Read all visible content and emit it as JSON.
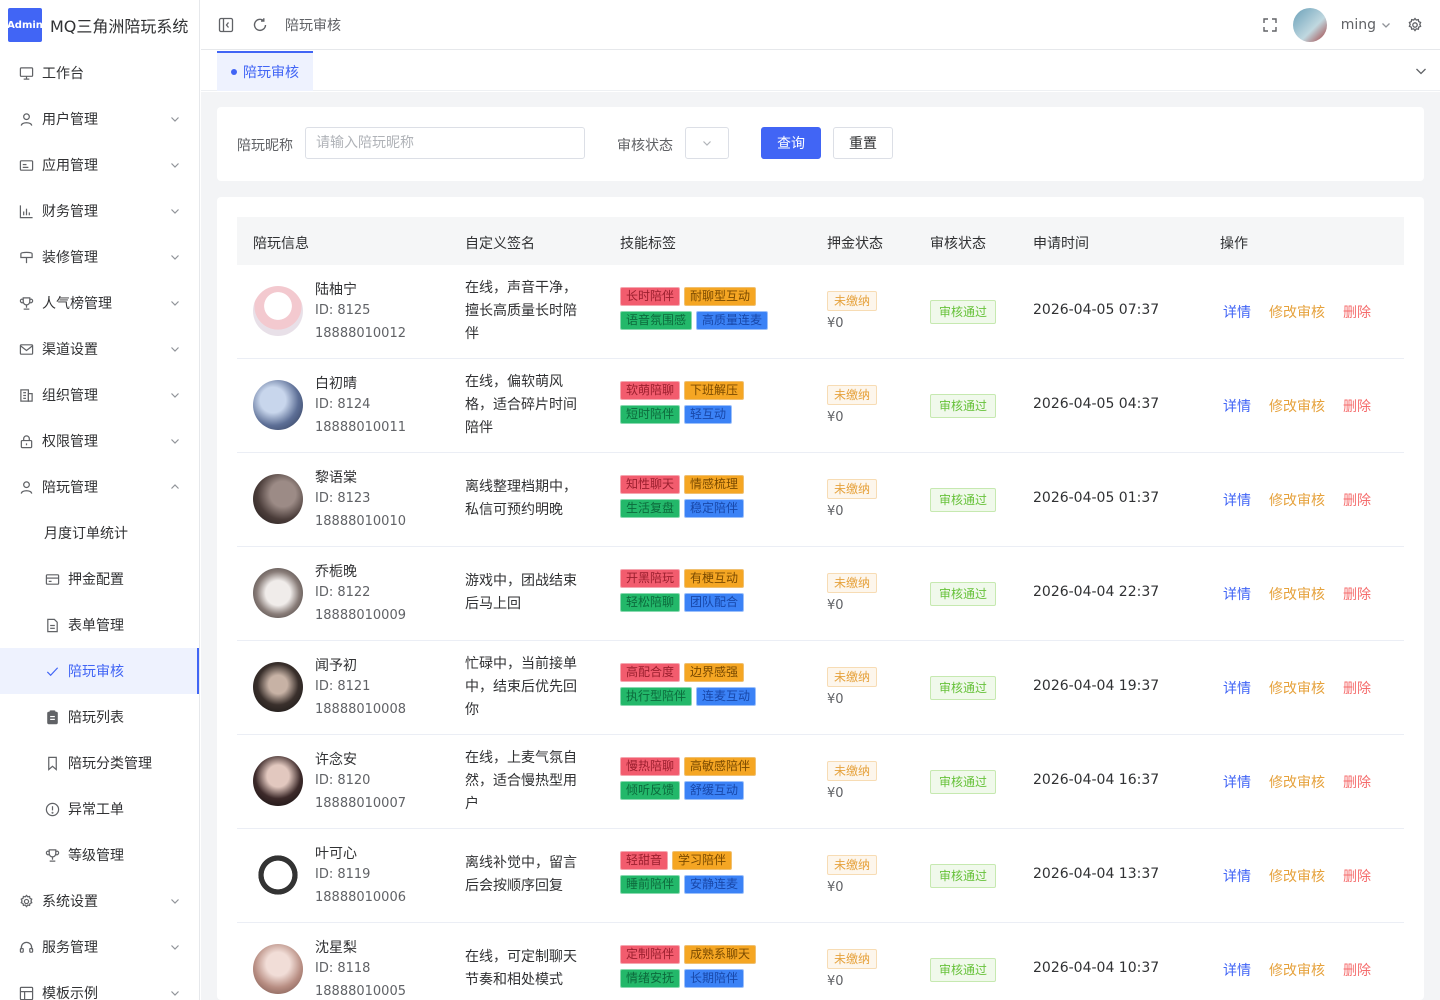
{
  "brand": {
    "logo": "Admin",
    "title": "MQ三角洲陪玩系统"
  },
  "menu": [
    {
      "label": "工作台",
      "icon": "monitor-icon",
      "arrow": false
    },
    {
      "label": "用户管理",
      "icon": "user-icon",
      "arrow": true
    },
    {
      "label": "应用管理",
      "icon": "app-icon",
      "arrow": true
    },
    {
      "label": "财务管理",
      "icon": "chart-icon",
      "arrow": true
    },
    {
      "label": "装修管理",
      "icon": "brush-icon",
      "arrow": true
    },
    {
      "label": "人气榜管理",
      "icon": "trophy-icon",
      "arrow": true
    },
    {
      "label": "渠道设置",
      "icon": "mail-icon",
      "arrow": true
    },
    {
      "label": "组织管理",
      "icon": "building-icon",
      "arrow": true
    },
    {
      "label": "权限管理",
      "icon": "lock-icon",
      "arrow": true
    },
    {
      "label": "陪玩管理",
      "icon": "user-icon",
      "arrow": "up"
    },
    {
      "label": "月度订单统计",
      "icon": "",
      "sub": true
    },
    {
      "label": "押金配置",
      "icon": "card-icon",
      "sub": true
    },
    {
      "label": "表单管理",
      "icon": "document-icon",
      "sub": true
    },
    {
      "label": "陪玩审核",
      "icon": "check-icon",
      "sub": true,
      "active": true
    },
    {
      "label": "陪玩列表",
      "icon": "clipboard-icon",
      "sub": true
    },
    {
      "label": "陪玩分类管理",
      "icon": "bookmark-icon",
      "sub": true
    },
    {
      "label": "异常工单",
      "icon": "info-icon",
      "sub": true
    },
    {
      "label": "等级管理",
      "icon": "trophy-icon",
      "sub": true
    },
    {
      "label": "系统设置",
      "icon": "gear-icon",
      "arrow": true
    },
    {
      "label": "服务管理",
      "icon": "headset-icon",
      "arrow": true
    },
    {
      "label": "模板示例",
      "icon": "template-icon",
      "arrow": true
    }
  ],
  "header": {
    "breadcrumb": "陪玩审核",
    "user_name": "ming"
  },
  "tab": {
    "label": "陪玩审核"
  },
  "search": {
    "nickname_label": "陪玩昵称",
    "nickname_placeholder": "请输入陪玩昵称",
    "status_label": "审核状态",
    "query_button": "查询",
    "reset_button": "重置"
  },
  "table": {
    "columns": [
      "陪玩信息",
      "自定义签名",
      "技能标签",
      "押金状态",
      "审核状态",
      "申请时间",
      "操作"
    ],
    "actions": {
      "detail": "详情",
      "edit": "修改审核",
      "delete": "删除"
    },
    "rows": [
      {
        "name": "陆柚宁",
        "id": "ID: 8125",
        "phone": "18888010012",
        "signature": "在线，声音干净，擅长高质量长时陪伴",
        "tags": [
          [
            "长时陪伴",
            "耐聊型互动"
          ],
          [
            "语音氛围感",
            "高质量连麦"
          ]
        ],
        "deposit_status": "未缴纳",
        "deposit_amount": "¥0",
        "audit_status": "审核通过",
        "time": "2026-04-05 07:37"
      },
      {
        "name": "白初晴",
        "id": "ID: 8124",
        "phone": "18888010011",
        "signature": "在线，偏软萌风格，适合碎片时间陪伴",
        "tags": [
          [
            "软萌陪聊",
            "下班解压"
          ],
          [
            "短时陪伴",
            "轻互动"
          ]
        ],
        "deposit_status": "未缴纳",
        "deposit_amount": "¥0",
        "audit_status": "审核通过",
        "time": "2026-04-05 04:37"
      },
      {
        "name": "黎语棠",
        "id": "ID: 8123",
        "phone": "18888010010",
        "signature": "离线整理档期中，私信可预约明晚",
        "tags": [
          [
            "知性聊天",
            "情感梳理"
          ],
          [
            "生活复盘",
            "稳定陪伴"
          ]
        ],
        "deposit_status": "未缴纳",
        "deposit_amount": "¥0",
        "audit_status": "审核通过",
        "time": "2026-04-05 01:37"
      },
      {
        "name": "乔栀晚",
        "id": "ID: 8122",
        "phone": "18888010009",
        "signature": "游戏中，团战结束后马上回",
        "tags": [
          [
            "开黑陪玩",
            "有梗互动"
          ],
          [
            "轻松陪聊",
            "团队配合"
          ]
        ],
        "deposit_status": "未缴纳",
        "deposit_amount": "¥0",
        "audit_status": "审核通过",
        "time": "2026-04-04 22:37"
      },
      {
        "name": "闻予初",
        "id": "ID: 8121",
        "phone": "18888010008",
        "signature": "忙碌中，当前接单中，结束后优先回你",
        "tags": [
          [
            "高配合度",
            "边界感强"
          ],
          [
            "执行型陪伴",
            "连麦互动"
          ]
        ],
        "deposit_status": "未缴纳",
        "deposit_amount": "¥0",
        "audit_status": "审核通过",
        "time": "2026-04-04 19:37"
      },
      {
        "name": "许念安",
        "id": "ID: 8120",
        "phone": "18888010007",
        "signature": "在线，上麦气氛自然，适合慢热型用户",
        "tags": [
          [
            "慢热陪聊",
            "高敏感陪伴"
          ],
          [
            "倾听反馈",
            "舒缓互动"
          ]
        ],
        "deposit_status": "未缴纳",
        "deposit_amount": "¥0",
        "audit_status": "审核通过",
        "time": "2026-04-04 16:37"
      },
      {
        "name": "叶可心",
        "id": "ID: 8119",
        "phone": "18888010006",
        "signature": "离线补觉中，留言后会按顺序回复",
        "tags": [
          [
            "轻甜音",
            "学习陪伴"
          ],
          [
            "睡前陪伴",
            "安静连麦"
          ]
        ],
        "deposit_status": "未缴纳",
        "deposit_amount": "¥0",
        "audit_status": "审核通过",
        "time": "2026-04-04 13:37"
      },
      {
        "name": "沈星梨",
        "id": "ID: 8118",
        "phone": "18888010005",
        "signature": "在线，可定制聊天节奏和相处模式",
        "tags": [
          [
            "定制陪伴",
            "成熟系聊天"
          ],
          [
            "情绪安抚",
            "长期陪伴"
          ]
        ],
        "deposit_status": "未缴纳",
        "deposit_amount": "¥0",
        "audit_status": "审核通过",
        "time": "2026-04-04 10:37"
      }
    ]
  },
  "colors": {
    "primary": "#4165f5",
    "warning": "#e6a23c",
    "danger": "#f56c6c",
    "success": "#67c23a"
  }
}
